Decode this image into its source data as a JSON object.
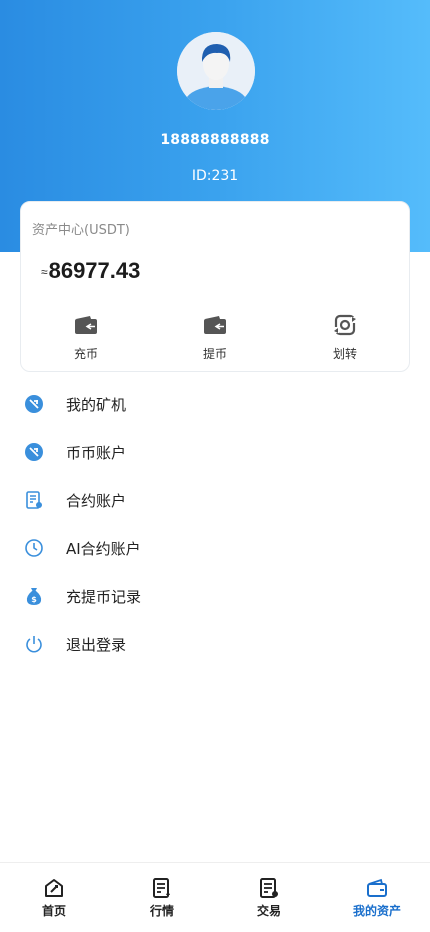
{
  "profile": {
    "phone": "18888888888",
    "id_text": "ID:231"
  },
  "assets": {
    "title": "资产中心(USDT)",
    "approx_symbol": "≈",
    "balance": "86977.43",
    "actions": [
      {
        "label": "充币",
        "icon": "wallet-icon"
      },
      {
        "label": "提币",
        "icon": "wallet-icon"
      },
      {
        "label": "划转",
        "icon": "transfer-icon"
      }
    ]
  },
  "menu": [
    {
      "label": "我的矿机",
      "icon": "mining-machine-icon"
    },
    {
      "label": "币币账户",
      "icon": "coin-account-icon"
    },
    {
      "label": "合约账户",
      "icon": "contract-icon"
    },
    {
      "label": "AI合约账户",
      "icon": "clock-icon"
    },
    {
      "label": "充提币记录",
      "icon": "money-bag-icon"
    },
    {
      "label": "退出登录",
      "icon": "power-icon"
    }
  ],
  "tabbar": [
    {
      "label": "首页",
      "icon": "home-icon",
      "active": false
    },
    {
      "label": "行情",
      "icon": "market-icon",
      "active": false
    },
    {
      "label": "交易",
      "icon": "trade-icon",
      "active": false
    },
    {
      "label": "我的资产",
      "icon": "wallet-icon",
      "active": true
    }
  ],
  "colors": {
    "header_gradient_start": "#2a8ce2",
    "header_gradient_end": "#55bcfb",
    "menu_icon": "#3a8fdc",
    "active_tab": "#1a6fcc"
  }
}
